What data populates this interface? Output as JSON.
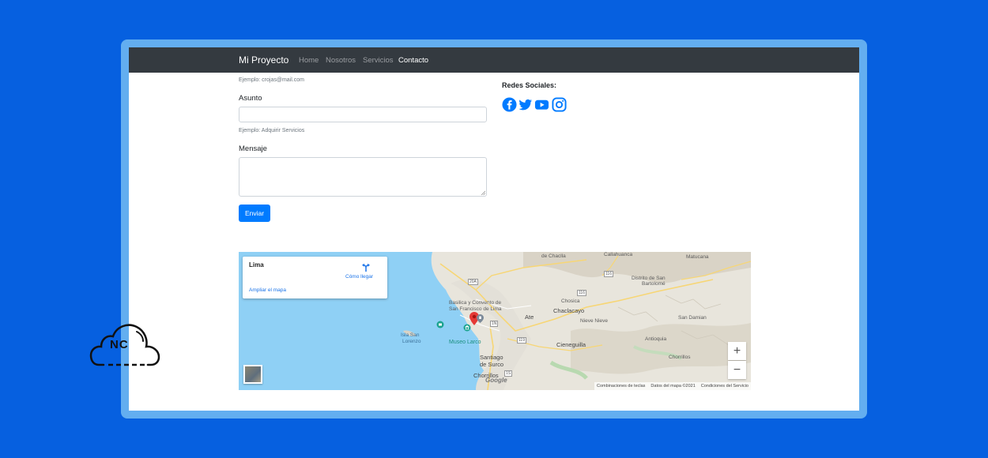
{
  "navbar": {
    "brand": "Mi Proyecto",
    "links": [
      "Home",
      "Nosotros",
      "Servicios",
      "Contacto"
    ],
    "active": "Contacto"
  },
  "form": {
    "email_help": "Ejemplo: crojas@mail.com",
    "asunto_label": "Asunto",
    "asunto_value": "",
    "asunto_help": "Ejemplo: Adquirir Servicios",
    "mensaje_label": "Mensaje",
    "mensaje_value": "",
    "submit_label": "Enviar"
  },
  "social": {
    "title": "Redes Sociales:",
    "icons": [
      "facebook-icon",
      "twitter-icon",
      "youtube-icon",
      "instagram-icon"
    ],
    "color": "#007bff"
  },
  "map": {
    "card_title": "Lima",
    "directions_label": "Cómo llegar",
    "expand_link": "Ampliar el mapa",
    "places": {
      "chaclla": "de Chaclla",
      "callahuanca": "Callahuanca",
      "matucana": "Matucana",
      "san_bartolome_1": "Distrito de San",
      "san_bartolome_2": "Bartolomé",
      "basilica_1": "Basilica y Convento de",
      "basilica_2": "San Francisco de Lima",
      "chosica": "Chosica",
      "chaclacayo": "Chaclacayo",
      "ate": "Ate",
      "nieve_nieve": "Nieve Nieve",
      "san_damian": "San Damian",
      "isla_1": "Isla San",
      "isla_2": "Lorenzo",
      "museo": "Museo Larco",
      "cieneguilla": "Cieneguilla",
      "antioquia": "Antioquia",
      "santiago_1": "Santiago",
      "santiago_2": "de Surco",
      "chorrillos": "Chorrillos",
      "chorrillos_r": "Chorrillos"
    },
    "road_labels": [
      "20A",
      "116",
      "116",
      "1N",
      "119",
      "1S"
    ],
    "zoom_in": "+",
    "zoom_out": "−",
    "attribution": {
      "shortcuts": "Combinaciones de teclas",
      "data": "Datos del mapa ©2021",
      "terms": "Condiciones del Servicio"
    },
    "google_logo": "Google"
  },
  "logo": {
    "text": "NC"
  }
}
